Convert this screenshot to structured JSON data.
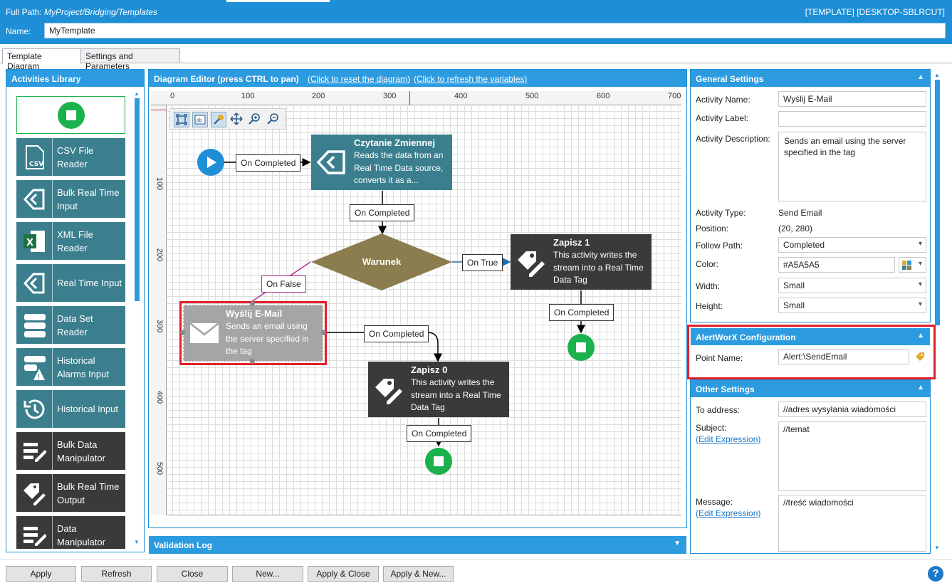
{
  "header": {
    "full_path_label": "Full Path:",
    "full_path_value": "MyProject/Bridging/Templates",
    "template_id": "[TEMPLATE] [DESKTOP-SBLRCUT]",
    "name_label": "Name:",
    "name_value": "MyTemplate"
  },
  "tabs": [
    {
      "label": "Template Diagram",
      "active": true
    },
    {
      "label": "Settings and Parameters",
      "active": false
    }
  ],
  "library": {
    "title": "Activities Library",
    "items": [
      {
        "label": "CSV File Reader",
        "icon": "csv-file-icon"
      },
      {
        "label": "Bulk Real Time Input",
        "icon": "tag-arrows-icon"
      },
      {
        "label": "XML File Reader",
        "icon": "excel-file-icon"
      },
      {
        "label": "Real Time Input",
        "icon": "tag-arrows-icon"
      },
      {
        "label": "Data Set Reader",
        "icon": "database-icon"
      },
      {
        "label": "Historical Alarms Input",
        "icon": "alarm-database-icon"
      },
      {
        "label": "Historical Input",
        "icon": "history-clock-icon"
      },
      {
        "label": "Bulk Data Manipulator",
        "icon": "edit-list-icon"
      },
      {
        "label": "Bulk Real Time Output",
        "icon": "tag-edit-icon"
      },
      {
        "label": "Data Manipulator",
        "icon": "edit-list-icon"
      }
    ]
  },
  "diagram": {
    "title": "Diagram Editor (press CTRL to pan)",
    "reset_link": "(Click to reset the diagram)",
    "refresh_link": "(Click to refresh the variables)",
    "ruler_h": [
      "0",
      "100",
      "200",
      "300",
      "400",
      "500",
      "600",
      "700"
    ],
    "ruler_v": [
      "100",
      "200",
      "300",
      "400",
      "500"
    ],
    "toolbar": [
      "fit-icon",
      "label-icon",
      "pin-icon",
      "move-icon",
      "zoom-in-icon",
      "zoom-out-icon"
    ],
    "nodes": {
      "czytanie": {
        "title": "Czytanie Zmiennej",
        "desc": "Reads the data from an Real Time Data source, converts it as a..."
      },
      "warunek": {
        "title": "Warunek"
      },
      "zapisz1": {
        "title": "Zapisz 1",
        "desc": "This activity writes the stream into a Real Time Data Tag"
      },
      "email": {
        "title": "Wyślij E-Mail",
        "desc": "Sends an email using the server specified in the tag"
      },
      "zapisz0": {
        "title": "Zapisz 0",
        "desc": "This activity writes the stream into a Real Time Data Tag"
      }
    },
    "edges": {
      "start_completed": "On Completed",
      "czytanie_completed": "On Completed",
      "on_true": "On True",
      "on_false": "On False",
      "zapisz1_completed": "On Completed",
      "email_completed": "On Completed",
      "zapisz0_completed": "On Completed"
    }
  },
  "validation": {
    "title": "Validation Log"
  },
  "general": {
    "title": "General Settings",
    "activity_name_label": "Activity Name:",
    "activity_name": "Wyślij E-Mail",
    "activity_label_label": "Activity Label:",
    "activity_label": "",
    "activity_desc_label": "Activity Description:",
    "activity_desc": "Sends an email using the server specified in the tag",
    "activity_type_label": "Activity Type:",
    "activity_type": "Send Email",
    "position_label": "Position:",
    "position": "(20, 280)",
    "follow_path_label": "Follow Path:",
    "follow_path": "Completed",
    "color_label": "Color:",
    "color": "#A5A5A5",
    "width_label": "Width:",
    "width": "Small",
    "height_label": "Height:",
    "height": "Small"
  },
  "alertworx": {
    "title": "AlertWorX Configuration",
    "point_name_label": "Point Name:",
    "point_name": "Alert:\\SendEmail"
  },
  "other": {
    "title": "Other Settings",
    "to_label": "To address:",
    "to_value": "//adres wysyłania wiadomości",
    "subject_label": "Subject:",
    "subject_link": "(Edit Expression)",
    "subject_value": "//temat",
    "message_label": "Message:",
    "message_link": "(Edit Expression)",
    "message_value": "//treść wiadomości"
  },
  "buttons": {
    "apply": "Apply",
    "refresh": "Refresh",
    "close": "Close",
    "new": "New...",
    "apply_close": "Apply & Close",
    "apply_new": "Apply & New..."
  },
  "colors": {
    "accent": "#1e8ed6",
    "teal_node": "#3b7f8e",
    "dark_node": "#3a3a3a",
    "decision": "#8b7d4e",
    "selected_node": "#A5A5A5",
    "highlight": "#e0202a",
    "start": "#1e8ed6",
    "stop": "#1bb14c"
  }
}
